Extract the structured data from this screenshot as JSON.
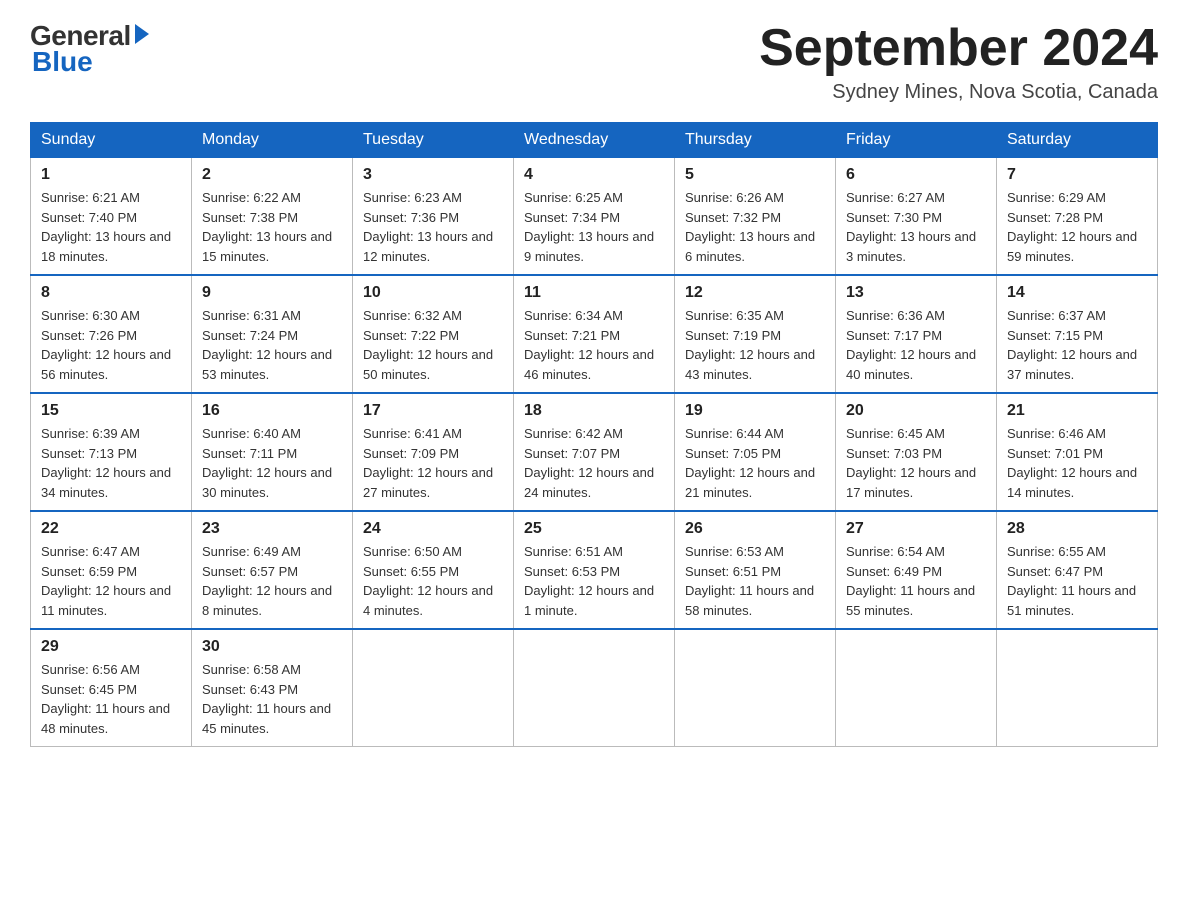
{
  "logo": {
    "general": "General",
    "blue": "Blue"
  },
  "title": "September 2024",
  "location": "Sydney Mines, Nova Scotia, Canada",
  "days_of_week": [
    "Sunday",
    "Monday",
    "Tuesday",
    "Wednesday",
    "Thursday",
    "Friday",
    "Saturday"
  ],
  "weeks": [
    [
      {
        "day": "1",
        "sunrise": "6:21 AM",
        "sunset": "7:40 PM",
        "daylight": "13 hours and 18 minutes."
      },
      {
        "day": "2",
        "sunrise": "6:22 AM",
        "sunset": "7:38 PM",
        "daylight": "13 hours and 15 minutes."
      },
      {
        "day": "3",
        "sunrise": "6:23 AM",
        "sunset": "7:36 PM",
        "daylight": "13 hours and 12 minutes."
      },
      {
        "day": "4",
        "sunrise": "6:25 AM",
        "sunset": "7:34 PM",
        "daylight": "13 hours and 9 minutes."
      },
      {
        "day": "5",
        "sunrise": "6:26 AM",
        "sunset": "7:32 PM",
        "daylight": "13 hours and 6 minutes."
      },
      {
        "day": "6",
        "sunrise": "6:27 AM",
        "sunset": "7:30 PM",
        "daylight": "13 hours and 3 minutes."
      },
      {
        "day": "7",
        "sunrise": "6:29 AM",
        "sunset": "7:28 PM",
        "daylight": "12 hours and 59 minutes."
      }
    ],
    [
      {
        "day": "8",
        "sunrise": "6:30 AM",
        "sunset": "7:26 PM",
        "daylight": "12 hours and 56 minutes."
      },
      {
        "day": "9",
        "sunrise": "6:31 AM",
        "sunset": "7:24 PM",
        "daylight": "12 hours and 53 minutes."
      },
      {
        "day": "10",
        "sunrise": "6:32 AM",
        "sunset": "7:22 PM",
        "daylight": "12 hours and 50 minutes."
      },
      {
        "day": "11",
        "sunrise": "6:34 AM",
        "sunset": "7:21 PM",
        "daylight": "12 hours and 46 minutes."
      },
      {
        "day": "12",
        "sunrise": "6:35 AM",
        "sunset": "7:19 PM",
        "daylight": "12 hours and 43 minutes."
      },
      {
        "day": "13",
        "sunrise": "6:36 AM",
        "sunset": "7:17 PM",
        "daylight": "12 hours and 40 minutes."
      },
      {
        "day": "14",
        "sunrise": "6:37 AM",
        "sunset": "7:15 PM",
        "daylight": "12 hours and 37 minutes."
      }
    ],
    [
      {
        "day": "15",
        "sunrise": "6:39 AM",
        "sunset": "7:13 PM",
        "daylight": "12 hours and 34 minutes."
      },
      {
        "day": "16",
        "sunrise": "6:40 AM",
        "sunset": "7:11 PM",
        "daylight": "12 hours and 30 minutes."
      },
      {
        "day": "17",
        "sunrise": "6:41 AM",
        "sunset": "7:09 PM",
        "daylight": "12 hours and 27 minutes."
      },
      {
        "day": "18",
        "sunrise": "6:42 AM",
        "sunset": "7:07 PM",
        "daylight": "12 hours and 24 minutes."
      },
      {
        "day": "19",
        "sunrise": "6:44 AM",
        "sunset": "7:05 PM",
        "daylight": "12 hours and 21 minutes."
      },
      {
        "day": "20",
        "sunrise": "6:45 AM",
        "sunset": "7:03 PM",
        "daylight": "12 hours and 17 minutes."
      },
      {
        "day": "21",
        "sunrise": "6:46 AM",
        "sunset": "7:01 PM",
        "daylight": "12 hours and 14 minutes."
      }
    ],
    [
      {
        "day": "22",
        "sunrise": "6:47 AM",
        "sunset": "6:59 PM",
        "daylight": "12 hours and 11 minutes."
      },
      {
        "day": "23",
        "sunrise": "6:49 AM",
        "sunset": "6:57 PM",
        "daylight": "12 hours and 8 minutes."
      },
      {
        "day": "24",
        "sunrise": "6:50 AM",
        "sunset": "6:55 PM",
        "daylight": "12 hours and 4 minutes."
      },
      {
        "day": "25",
        "sunrise": "6:51 AM",
        "sunset": "6:53 PM",
        "daylight": "12 hours and 1 minute."
      },
      {
        "day": "26",
        "sunrise": "6:53 AM",
        "sunset": "6:51 PM",
        "daylight": "11 hours and 58 minutes."
      },
      {
        "day": "27",
        "sunrise": "6:54 AM",
        "sunset": "6:49 PM",
        "daylight": "11 hours and 55 minutes."
      },
      {
        "day": "28",
        "sunrise": "6:55 AM",
        "sunset": "6:47 PM",
        "daylight": "11 hours and 51 minutes."
      }
    ],
    [
      {
        "day": "29",
        "sunrise": "6:56 AM",
        "sunset": "6:45 PM",
        "daylight": "11 hours and 48 minutes."
      },
      {
        "day": "30",
        "sunrise": "6:58 AM",
        "sunset": "6:43 PM",
        "daylight": "11 hours and 45 minutes."
      },
      null,
      null,
      null,
      null,
      null
    ]
  ],
  "labels": {
    "sunrise": "Sunrise:",
    "sunset": "Sunset:",
    "daylight": "Daylight:"
  }
}
